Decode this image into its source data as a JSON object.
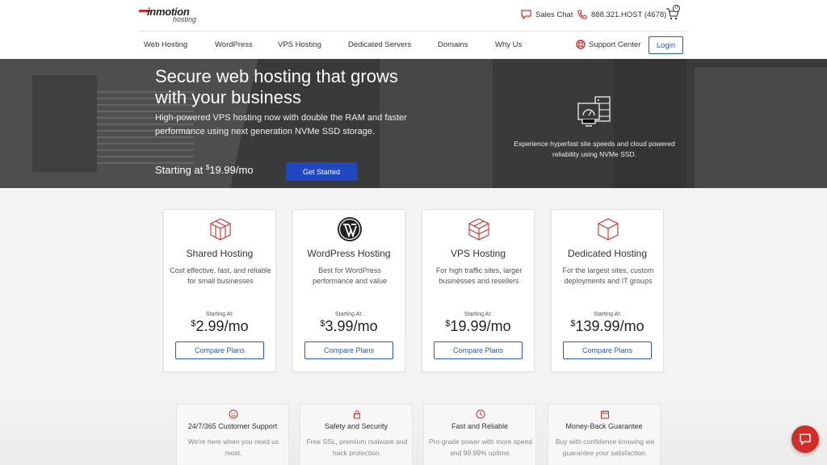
{
  "header": {
    "logo_main": "inmotion",
    "logo_sub": "hosting",
    "sales_chat": "Sales Chat",
    "phone": "888.321.HOST (4678)",
    "cart_count": "0"
  },
  "nav": {
    "items": [
      "Web Hosting",
      "WordPress",
      "VPS Hosting",
      "Dedicated Servers",
      "Domains",
      "Why Us"
    ],
    "support": "Support Center",
    "login": "Login"
  },
  "hero": {
    "title": "Secure web hosting that grows with your business",
    "desc": "High-powered VPS hosting now with double the RAM and faster performance using next generation NVMe SSD storage.",
    "price_prefix": "Starting at ",
    "price_currency": "$",
    "price_value": "19.99",
    "price_suffix": "/mo",
    "cta": "Get Started",
    "side_text": "Experience hyperfast site speeds and cloud powered reliability using NVMe SSD."
  },
  "cards": [
    {
      "title": "Shared Hosting",
      "desc": "Cost effective, fast, and reliable for small businesses",
      "start": "Starting At:",
      "currency": "$",
      "price": "2.99",
      "unit": "/mo",
      "btn": "Compare Plans",
      "icon": "cube-icon"
    },
    {
      "title": "WordPress Hosting",
      "desc": "Best for WordPress performance and value",
      "start": "Starting At:",
      "currency": "$",
      "price": "3.99",
      "unit": "/mo",
      "btn": "Compare Plans",
      "icon": "wordpress-icon"
    },
    {
      "title": "VPS Hosting",
      "desc": "For high traffic sites, larger businesses and resellers",
      "start": "Starting At:",
      "currency": "$",
      "price": "19.99",
      "unit": "/mo",
      "btn": "Compare Plans",
      "icon": "cube-icon"
    },
    {
      "title": "Dedicated Hosting",
      "desc": "For the largest sites, custom deployments and IT groups",
      "start": "Starting At:",
      "currency": "$",
      "price": "139.99",
      "unit": "/mo",
      "btn": "Compare Plans",
      "icon": "cube-icon"
    }
  ],
  "features": [
    {
      "title": "24/7/365 Customer Support",
      "desc": "We're here when you need us most.",
      "icon": "smiley-icon"
    },
    {
      "title": "Safety and Security",
      "desc": "Free SSL, premium malware and hack protection.",
      "icon": "lock-icon"
    },
    {
      "title": "Fast and Reliable",
      "desc": "Pro-grade power with more speed and 99.99% uptime.",
      "icon": "clock-icon"
    },
    {
      "title": "Money-Back Guarantee",
      "desc": "Buy with confidence knowing we guarantee your satisfaction.",
      "icon": "calendar-icon"
    }
  ],
  "colors": {
    "brand_red": "#d32d27",
    "brand_blue": "#2148c0",
    "link_blue": "#2b5bb5"
  }
}
